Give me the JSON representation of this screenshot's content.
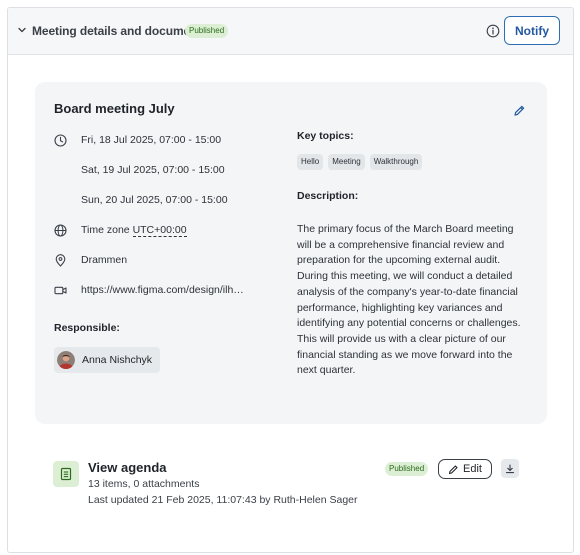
{
  "header": {
    "title": "Meeting details and documents",
    "status_badge": "Published",
    "notify_label": "Notify",
    "chevron_icon": "chevron-down-icon",
    "info_icon": "info-icon"
  },
  "meeting": {
    "title": "Board meeting July",
    "dates": [
      "Fri, 18 Jul 2025, 07:00 - 15:00",
      "Sat, 19 Jul 2025, 07:00 - 15:00",
      "Sun, 20 Jul 2025, 07:00 - 15:00"
    ],
    "timezone_prefix": "Time zone",
    "timezone_value": "UTC+00:00",
    "location": "Drammen",
    "video_link": "https://www.figma.com/design/ilh…",
    "responsible_label": "Responsible:",
    "responsible_name": "Anna Nishchyk",
    "key_topics_label": "Key topics:",
    "key_topics": [
      "Hello",
      "Meeting",
      "Walkthrough"
    ],
    "description_label": "Description:",
    "description": "The primary focus of the March Board meeting will be a comprehensive financial review and preparation for the upcoming external audit. During this meeting, we will conduct a detailed analysis of the company's year-to-date financial performance, highlighting key variances and identifying any potential concerns or challenges. This will provide us with a clear picture of our financial standing as we move forward into the next quarter."
  },
  "agenda": {
    "title": "View agenda",
    "items_summary": "13 items, 0 attachments",
    "last_updated": "Last updated 21 Feb 2025, 11:07:43 by Ruth-Helen Sager",
    "status_badge": "Published",
    "edit_label": "Edit"
  },
  "colors": {
    "accent": "#2e6db4",
    "published_bg": "#dcefd4",
    "published_text": "#2b6a1c",
    "card_bg": "#f3f5f7"
  }
}
